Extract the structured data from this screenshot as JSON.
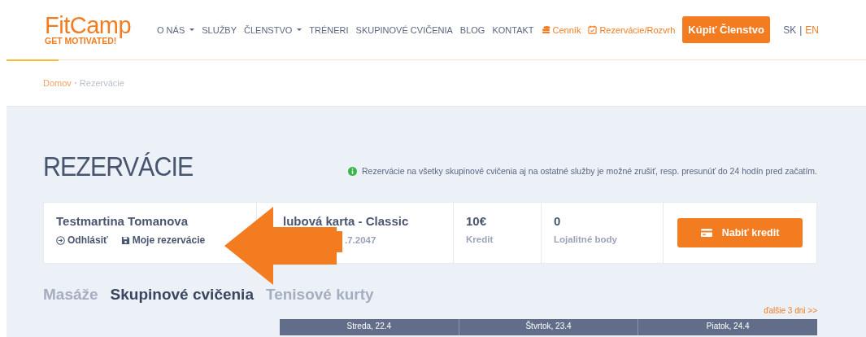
{
  "logo": {
    "name": "FitCamp",
    "tagline": "GET MOTIVATED!"
  },
  "nav": [
    {
      "label": "O NÁS",
      "kind": "dropdown"
    },
    {
      "label": "SLUŽBY",
      "kind": "link"
    },
    {
      "label": "ČLENSTVO",
      "kind": "dropdown"
    },
    {
      "label": "TRÉNERI",
      "kind": "link"
    },
    {
      "label": "SKUPINOVÉ CVIČENIA",
      "kind": "link"
    },
    {
      "label": "BLOG",
      "kind": "link"
    },
    {
      "label": "KONTAKT",
      "kind": "link"
    },
    {
      "label": "Cenník",
      "kind": "coins"
    },
    {
      "label": "Rezervácie/Rozvrh",
      "kind": "calendar"
    }
  ],
  "cta": "Kúpiť Členstvo",
  "language_separator": "|",
  "languages": [
    {
      "label": "SK",
      "selected": false
    },
    {
      "label": "EN",
      "selected": true
    }
  ],
  "breadcrumb": [
    "Domov",
    "Rezervácie"
  ],
  "title": "REZERVÁCIE",
  "notice": "Rezervácie na všetky skupinové cvičenia aj na ostatné služby je možné zrušiť, resp. presunúť do 24 hodín pred začatím.",
  "account": {
    "name": "Testmartina Tomanova",
    "logout": "Odhlásiť",
    "my_reservations": "Moje rezervácie",
    "membership": "lubová karta - Classic",
    "valid_until": ".7.2047",
    "credit": "10€",
    "credit_label": "Kredit",
    "points": "0",
    "points_label": "Lojalitné body",
    "topup": "Nabiť kredit"
  },
  "tabs": [
    {
      "label": "Masáže",
      "selected": false
    },
    {
      "label": "Skupinové cvičenia",
      "selected": true
    },
    {
      "label": "Tenisové kurty",
      "selected": false
    }
  ],
  "next_days": "ďalšie 3 dni >>",
  "days": [
    "Streda, 22.4",
    "Štvrtok, 23.4",
    "Piatok, 24.4"
  ]
}
